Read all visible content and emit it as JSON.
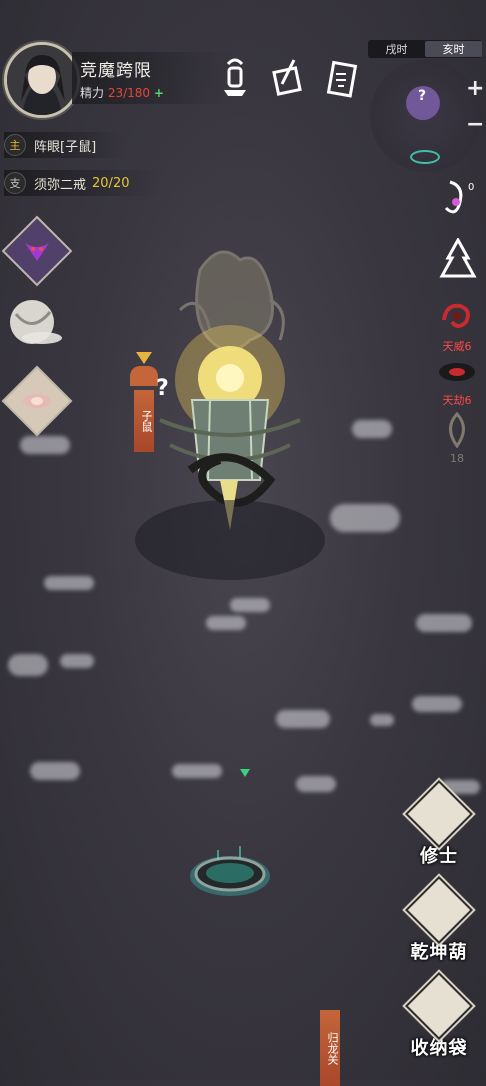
{
  "header": {
    "character_name": "竞魔跨限",
    "energy_label": "精力",
    "energy_value": "23/180",
    "energy_plus": "+"
  },
  "time": {
    "option_a": "戌时",
    "option_b": "亥时"
  },
  "minimap": {
    "zoom_in": "+",
    "zoom_out": "−",
    "unknown_marker": "?"
  },
  "quests": {
    "main": {
      "tag": "主",
      "text": "阵眼[子鼠]"
    },
    "side": {
      "tag": "支",
      "text": "须弥二戒",
      "count": "20/20"
    }
  },
  "right_status": {
    "badge_count": "0",
    "tianwei": "天威6",
    "tianjie": "天劫6",
    "faded_count": "18"
  },
  "map": {
    "zishu_banner": "子鼠",
    "unknown_marker": "?",
    "guilong_banner": "归龙关"
  },
  "nav": {
    "cultivator": "修士",
    "qiankun_gourd": "乾坤葫",
    "storage_bag": "收纳袋"
  },
  "icons": {
    "top": [
      "shrine-bell-icon",
      "brush-scroll-icon",
      "talisman-icon"
    ],
    "left": [
      "demon-mask-icon",
      "spirit-gourd-icon",
      "lotus-icon"
    ]
  }
}
